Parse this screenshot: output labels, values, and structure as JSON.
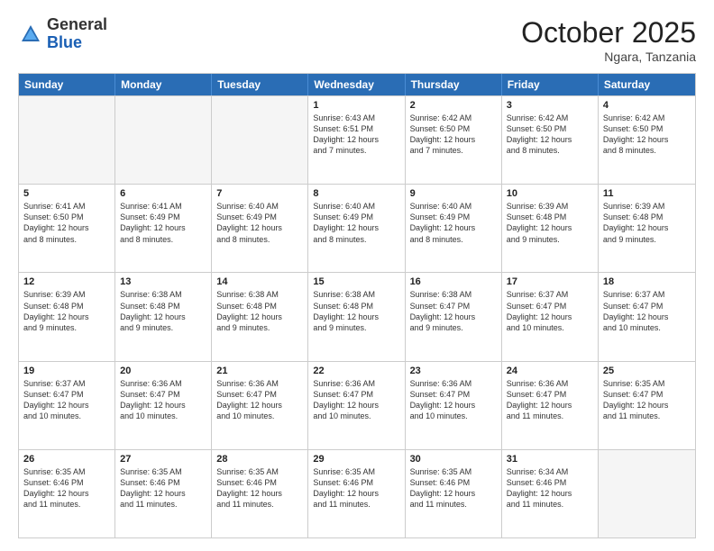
{
  "header": {
    "logo_general": "General",
    "logo_blue": "Blue",
    "month_title": "October 2025",
    "location": "Ngara, Tanzania"
  },
  "days_of_week": [
    "Sunday",
    "Monday",
    "Tuesday",
    "Wednesday",
    "Thursday",
    "Friday",
    "Saturday"
  ],
  "rows": [
    [
      {
        "day": "",
        "text": "",
        "empty": true
      },
      {
        "day": "",
        "text": "",
        "empty": true
      },
      {
        "day": "",
        "text": "",
        "empty": true
      },
      {
        "day": "1",
        "text": "Sunrise: 6:43 AM\nSunset: 6:51 PM\nDaylight: 12 hours\nand 7 minutes.",
        "empty": false
      },
      {
        "day": "2",
        "text": "Sunrise: 6:42 AM\nSunset: 6:50 PM\nDaylight: 12 hours\nand 7 minutes.",
        "empty": false
      },
      {
        "day": "3",
        "text": "Sunrise: 6:42 AM\nSunset: 6:50 PM\nDaylight: 12 hours\nand 8 minutes.",
        "empty": false
      },
      {
        "day": "4",
        "text": "Sunrise: 6:42 AM\nSunset: 6:50 PM\nDaylight: 12 hours\nand 8 minutes.",
        "empty": false
      }
    ],
    [
      {
        "day": "5",
        "text": "Sunrise: 6:41 AM\nSunset: 6:50 PM\nDaylight: 12 hours\nand 8 minutes.",
        "empty": false
      },
      {
        "day": "6",
        "text": "Sunrise: 6:41 AM\nSunset: 6:49 PM\nDaylight: 12 hours\nand 8 minutes.",
        "empty": false
      },
      {
        "day": "7",
        "text": "Sunrise: 6:40 AM\nSunset: 6:49 PM\nDaylight: 12 hours\nand 8 minutes.",
        "empty": false
      },
      {
        "day": "8",
        "text": "Sunrise: 6:40 AM\nSunset: 6:49 PM\nDaylight: 12 hours\nand 8 minutes.",
        "empty": false
      },
      {
        "day": "9",
        "text": "Sunrise: 6:40 AM\nSunset: 6:49 PM\nDaylight: 12 hours\nand 8 minutes.",
        "empty": false
      },
      {
        "day": "10",
        "text": "Sunrise: 6:39 AM\nSunset: 6:48 PM\nDaylight: 12 hours\nand 9 minutes.",
        "empty": false
      },
      {
        "day": "11",
        "text": "Sunrise: 6:39 AM\nSunset: 6:48 PM\nDaylight: 12 hours\nand 9 minutes.",
        "empty": false
      }
    ],
    [
      {
        "day": "12",
        "text": "Sunrise: 6:39 AM\nSunset: 6:48 PM\nDaylight: 12 hours\nand 9 minutes.",
        "empty": false
      },
      {
        "day": "13",
        "text": "Sunrise: 6:38 AM\nSunset: 6:48 PM\nDaylight: 12 hours\nand 9 minutes.",
        "empty": false
      },
      {
        "day": "14",
        "text": "Sunrise: 6:38 AM\nSunset: 6:48 PM\nDaylight: 12 hours\nand 9 minutes.",
        "empty": false
      },
      {
        "day": "15",
        "text": "Sunrise: 6:38 AM\nSunset: 6:48 PM\nDaylight: 12 hours\nand 9 minutes.",
        "empty": false
      },
      {
        "day": "16",
        "text": "Sunrise: 6:38 AM\nSunset: 6:47 PM\nDaylight: 12 hours\nand 9 minutes.",
        "empty": false
      },
      {
        "day": "17",
        "text": "Sunrise: 6:37 AM\nSunset: 6:47 PM\nDaylight: 12 hours\nand 10 minutes.",
        "empty": false
      },
      {
        "day": "18",
        "text": "Sunrise: 6:37 AM\nSunset: 6:47 PM\nDaylight: 12 hours\nand 10 minutes.",
        "empty": false
      }
    ],
    [
      {
        "day": "19",
        "text": "Sunrise: 6:37 AM\nSunset: 6:47 PM\nDaylight: 12 hours\nand 10 minutes.",
        "empty": false
      },
      {
        "day": "20",
        "text": "Sunrise: 6:36 AM\nSunset: 6:47 PM\nDaylight: 12 hours\nand 10 minutes.",
        "empty": false
      },
      {
        "day": "21",
        "text": "Sunrise: 6:36 AM\nSunset: 6:47 PM\nDaylight: 12 hours\nand 10 minutes.",
        "empty": false
      },
      {
        "day": "22",
        "text": "Sunrise: 6:36 AM\nSunset: 6:47 PM\nDaylight: 12 hours\nand 10 minutes.",
        "empty": false
      },
      {
        "day": "23",
        "text": "Sunrise: 6:36 AM\nSunset: 6:47 PM\nDaylight: 12 hours\nand 10 minutes.",
        "empty": false
      },
      {
        "day": "24",
        "text": "Sunrise: 6:36 AM\nSunset: 6:47 PM\nDaylight: 12 hours\nand 11 minutes.",
        "empty": false
      },
      {
        "day": "25",
        "text": "Sunrise: 6:35 AM\nSunset: 6:47 PM\nDaylight: 12 hours\nand 11 minutes.",
        "empty": false
      }
    ],
    [
      {
        "day": "26",
        "text": "Sunrise: 6:35 AM\nSunset: 6:46 PM\nDaylight: 12 hours\nand 11 minutes.",
        "empty": false
      },
      {
        "day": "27",
        "text": "Sunrise: 6:35 AM\nSunset: 6:46 PM\nDaylight: 12 hours\nand 11 minutes.",
        "empty": false
      },
      {
        "day": "28",
        "text": "Sunrise: 6:35 AM\nSunset: 6:46 PM\nDaylight: 12 hours\nand 11 minutes.",
        "empty": false
      },
      {
        "day": "29",
        "text": "Sunrise: 6:35 AM\nSunset: 6:46 PM\nDaylight: 12 hours\nand 11 minutes.",
        "empty": false
      },
      {
        "day": "30",
        "text": "Sunrise: 6:35 AM\nSunset: 6:46 PM\nDaylight: 12 hours\nand 11 minutes.",
        "empty": false
      },
      {
        "day": "31",
        "text": "Sunrise: 6:34 AM\nSunset: 6:46 PM\nDaylight: 12 hours\nand 11 minutes.",
        "empty": false
      },
      {
        "day": "",
        "text": "",
        "empty": true
      }
    ]
  ]
}
